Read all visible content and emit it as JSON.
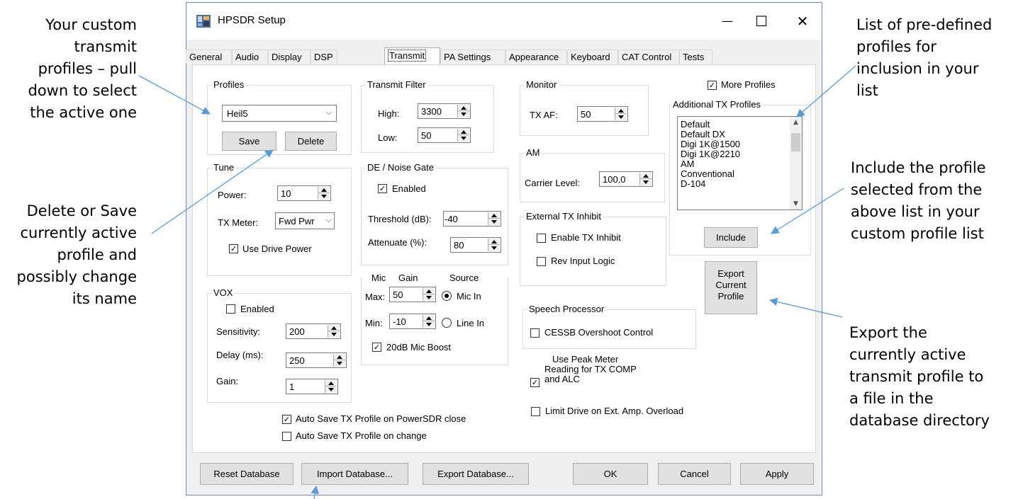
{
  "annotations": {
    "profiles": [
      "Your custom",
      "transmit",
      "profiles – pull",
      "down to select",
      "the active one"
    ],
    "delete_save": [
      "Delete or Save",
      "currently active",
      "profile and",
      "possibly change",
      "its name"
    ],
    "predefined": [
      "List of pre-defined",
      "profiles for",
      "inclusion in your",
      "list"
    ],
    "include": [
      "Include the profile",
      "selected from the",
      "above list in your",
      "custom profile list"
    ],
    "export": [
      "Export the",
      "currently active",
      "transmit profile to",
      "a file in the",
      "database directory"
    ]
  },
  "window": {
    "title": "HPSDR Setup",
    "minimize": "—",
    "maximize": "☐",
    "close": "✕"
  },
  "tabs": [
    "General",
    "Audio",
    "Display",
    "DSP",
    "Transmit",
    "PA Settings",
    "Appearance",
    "Keyboard",
    "CAT Control",
    "Tests"
  ],
  "active_tab": "Transmit",
  "profiles": {
    "title": "Profiles",
    "selected": "Heil5",
    "save": "Save",
    "delete": "Delete"
  },
  "tune": {
    "title": "Tune",
    "power_label": "Power:",
    "power_value": "10",
    "tx_meter_label": "TX Meter:",
    "tx_meter_value": "Fwd Pwr",
    "use_drive_power": "Use Drive Power"
  },
  "vox": {
    "title": "VOX",
    "enabled": "Enabled",
    "sensitivity_label": "Sensitivity:",
    "sensitivity_value": "200",
    "delay_label": "Delay (ms):",
    "delay_value": "250",
    "gain_label": "Gain:",
    "gain_value": "1"
  },
  "transmit_filter": {
    "title": "Transmit Filter",
    "high_label": "High:",
    "high_value": "3300",
    "low_label": "Low:",
    "low_value": "50"
  },
  "noise_gate": {
    "title": "DE / Noise Gate",
    "enabled": "Enabled",
    "threshold_label": "Threshold (dB):",
    "threshold_value": "-40",
    "attenuate_label": "Attenuate (%):",
    "attenuate_value": "80"
  },
  "mic": {
    "mic_label": "Mic",
    "gain_label": "Gain",
    "source_label": "Source",
    "max_label": "Max:",
    "max_value": "50",
    "min_label": "Min:",
    "min_value": "-10",
    "mic_in": "Mic In",
    "line_in": "Line In",
    "boost": "20dB Mic Boost"
  },
  "monitor": {
    "title": "Monitor",
    "tx_af_label": "TX AF:",
    "tx_af_value": "50"
  },
  "am": {
    "title": "AM",
    "carrier_label": "Carrier Level:",
    "carrier_value": "100.0"
  },
  "tx_inhibit": {
    "title": "External TX Inhibit",
    "enable": "Enable TX Inhibit",
    "rev": "Rev Input Logic"
  },
  "speech": {
    "title": "Speech Processor",
    "cessb": "CESSB Overshoot Control"
  },
  "peak_meter": {
    "line1": "Use Peak Meter",
    "line2": "Reading for TX COMP",
    "line3": "and ALC"
  },
  "limit_drive": "Limit Drive on Ext. Amp. Overload",
  "more_profiles": "More Profiles",
  "additional": {
    "title": "Additional TX Profiles",
    "items": [
      "Default",
      "Default DX",
      "Digi 1K@1500",
      "Digi 1K@2210",
      "AM",
      "Conventional",
      "D-104"
    ],
    "include": "Include"
  },
  "export_profile": [
    "Export",
    "Current",
    "Profile"
  ],
  "autosave_close": "Auto Save TX Profile on PowerSDR close",
  "autosave_change": "Auto Save TX Profile on change",
  "bottom": {
    "reset": "Reset Database",
    "import": "Import Database...",
    "export": "Export Database...",
    "ok": "OK",
    "cancel": "Cancel",
    "apply": "Apply"
  },
  "colors": {
    "arrow": "#5b9bd5",
    "window_border": "#6d89b5",
    "dialog_bg": "#f0f0f0"
  }
}
